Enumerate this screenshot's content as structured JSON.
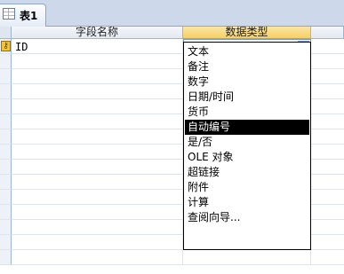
{
  "tab": {
    "label": "表1",
    "icon": "table-icon"
  },
  "columns": {
    "field_name": "字段名称",
    "data_type": "数据类型"
  },
  "rows": [
    {
      "field_name": "ID",
      "data_type": "自动编号",
      "primary_key": true
    }
  ],
  "dropdown": {
    "options": [
      "文本",
      "备注",
      "数字",
      "日期/时间",
      "货币",
      "自动编号",
      "是/否",
      "OLE 对象",
      "超链接",
      "附件",
      "计算",
      "查阅向导..."
    ],
    "selected_index": 5
  },
  "colors": {
    "tab_strip": "#cdd9ea",
    "active_header": "#f6cf63",
    "grid_line": "#dde5ef",
    "selection": "#000000"
  }
}
